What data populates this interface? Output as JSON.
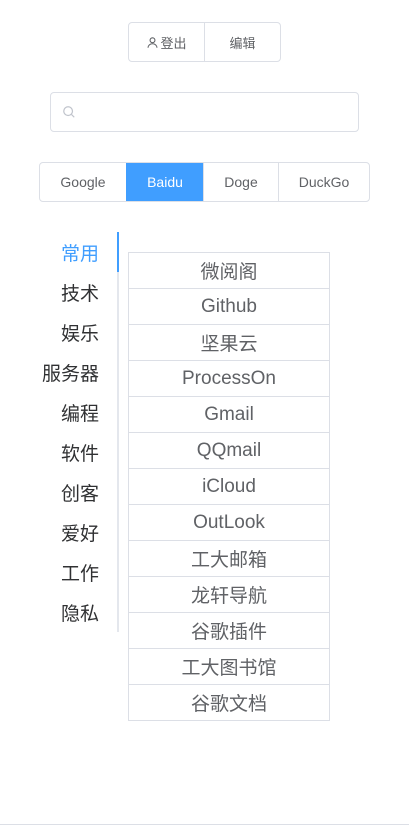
{
  "top_actions": {
    "logout_label": "登出",
    "edit_label": "编辑"
  },
  "search": {
    "value": "",
    "placeholder": ""
  },
  "engines": [
    {
      "label": "Google",
      "active": false
    },
    {
      "label": "Baidu",
      "active": true
    },
    {
      "label": "Doge",
      "active": false
    },
    {
      "label": "DuckGo",
      "active": false
    }
  ],
  "categories": [
    {
      "label": "常用",
      "active": true
    },
    {
      "label": "技术",
      "active": false
    },
    {
      "label": "娱乐",
      "active": false
    },
    {
      "label": "服务器",
      "active": false
    },
    {
      "label": "编程",
      "active": false
    },
    {
      "label": "软件",
      "active": false
    },
    {
      "label": "创客",
      "active": false
    },
    {
      "label": "爱好",
      "active": false
    },
    {
      "label": "工作",
      "active": false
    },
    {
      "label": "隐私",
      "active": false
    }
  ],
  "links": [
    "微阅阁",
    "Github",
    "坚果云",
    "ProcessOn",
    "Gmail",
    "QQmail",
    "iCloud",
    "OutLook",
    "工大邮箱",
    "龙轩导航",
    "谷歌插件",
    "工大图书馆",
    "谷歌文档"
  ],
  "colors": {
    "accent": "#409eff",
    "border": "#dcdfe6",
    "text": "#606266"
  },
  "icons": {
    "logout": "user-icon",
    "search": "search-icon"
  }
}
